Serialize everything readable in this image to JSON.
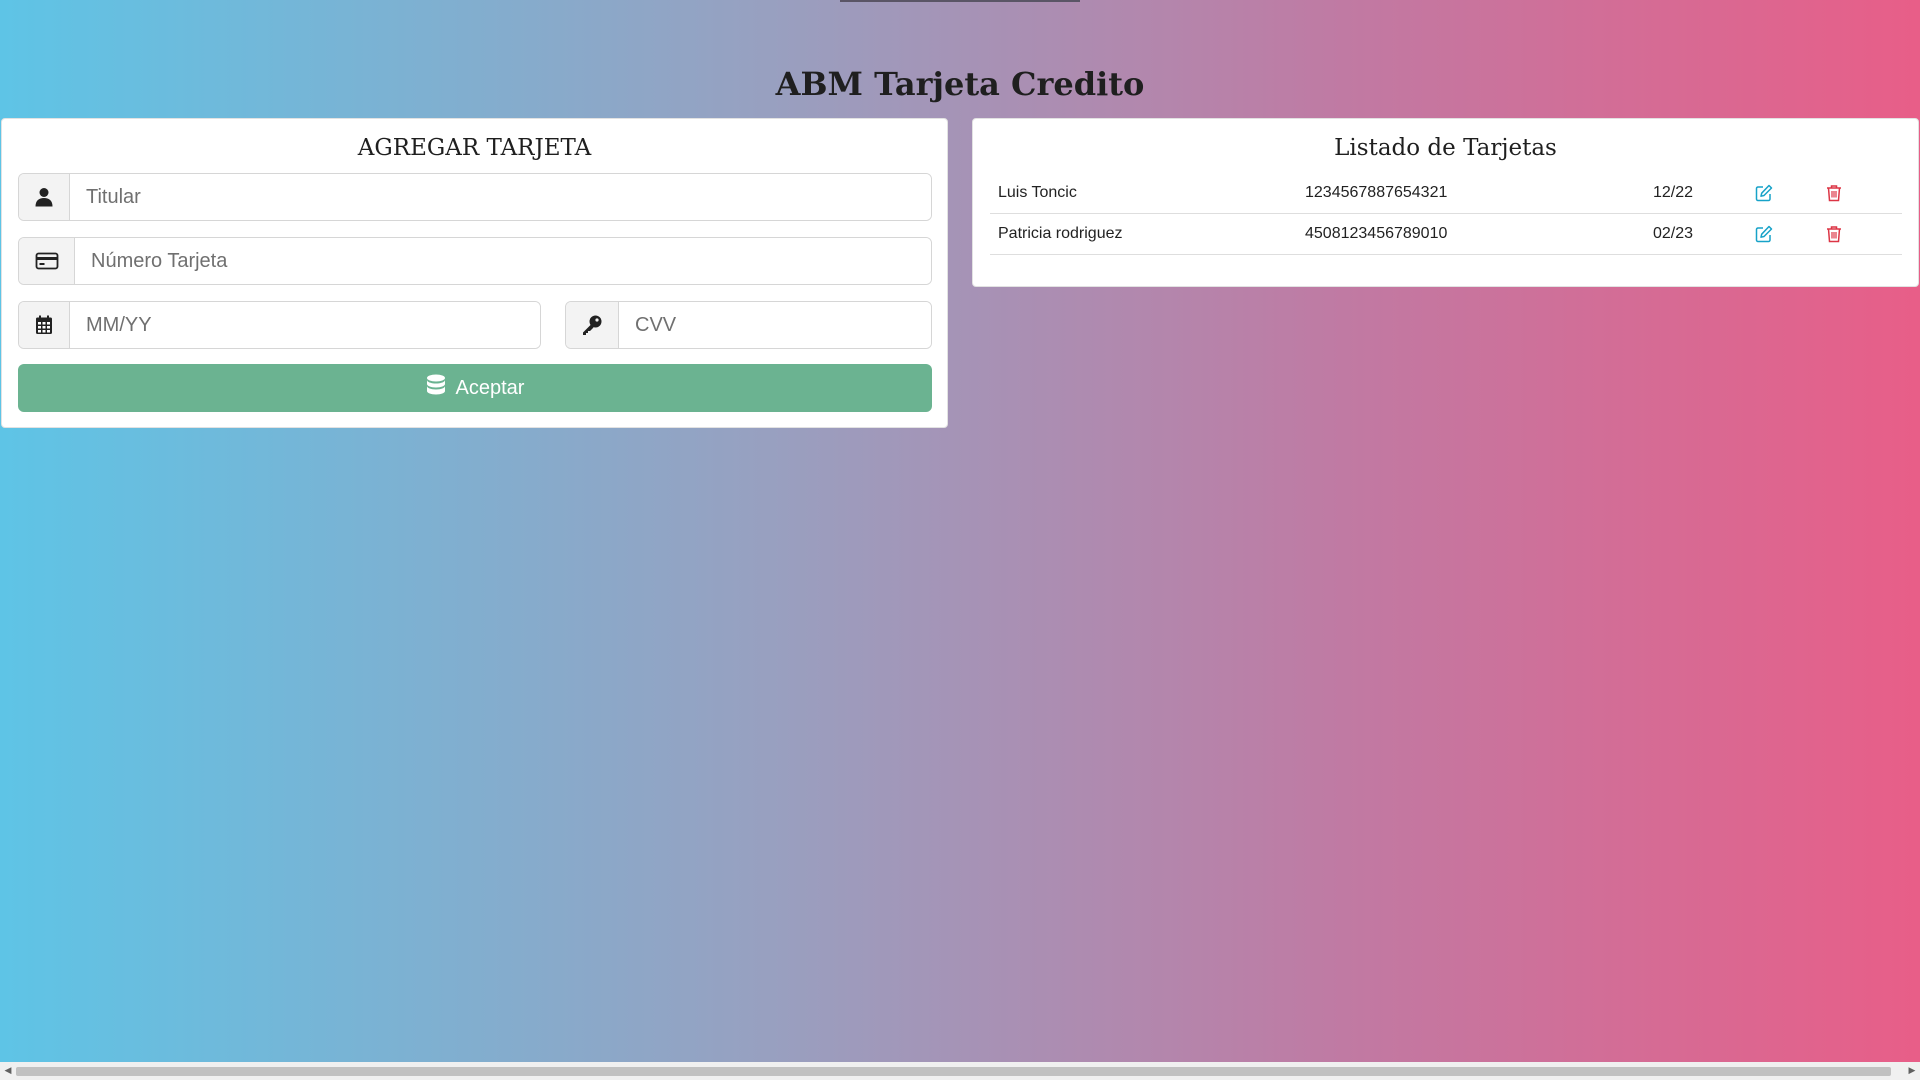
{
  "page": {
    "title": "ABM Tarjeta Credito"
  },
  "form": {
    "title": "AGREGAR TARJETA",
    "titular": {
      "placeholder": "Titular",
      "value": "",
      "icon": "user-icon"
    },
    "numero": {
      "placeholder": "Número Tarjeta",
      "value": "",
      "icon": "credit-card-icon"
    },
    "expiry": {
      "placeholder": "MM/YY",
      "value": "",
      "icon": "calendar-icon"
    },
    "cvv": {
      "placeholder": "CVV",
      "value": "",
      "icon": "key-icon"
    },
    "submit_label": "Aceptar",
    "submit_icon": "database-icon"
  },
  "list": {
    "title": "Listado de Tarjetas",
    "cards": [
      {
        "titular": "Luis Toncic",
        "numero": "1234567887654321",
        "expiry": "12/22"
      },
      {
        "titular": "Patricia rodriguez",
        "numero": "4508123456789010",
        "expiry": "02/23"
      }
    ]
  },
  "colors": {
    "accept_button": "#6bb391",
    "edit_icon": "#17a2c8",
    "delete_icon": "#dc3545",
    "gradient_start": "#5ec4e6",
    "gradient_end": "#e85e88"
  }
}
